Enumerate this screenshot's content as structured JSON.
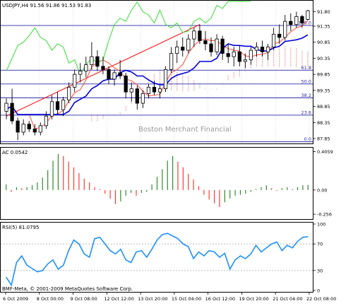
{
  "colors": {
    "background": "#ffffff",
    "frame": "#000000",
    "grid": "#c9c9c9",
    "candle": "#000000",
    "candle_up_fill": "#ffffff",
    "fib_line": "#2a2aa8",
    "fib_label": "#2a2aa8",
    "trendline": "#ff0000",
    "chikou": "#33dd33",
    "tenkan": "#ff4a3a",
    "kijun": "#0000dd",
    "cloud": "#e8a0a0",
    "cloud_dots": "#ffb080",
    "ac_up": "#2e8b2e",
    "ac_down": "#ff3b30",
    "rsi_line": "#1e90ff",
    "rsi_level": "#b5b5b5",
    "watermark": "#9a9a9a"
  },
  "main_panel": {
    "title": "USDJPY,H4  91.56 91.86 91.53 91.83",
    "watermark": "Boston Merchant Financial",
    "fib_levels": [
      {
        "label": "100.0",
        "price": 91.37
      },
      {
        "label": "61.8",
        "price": 89.98
      },
      {
        "label": "50.0",
        "price": 89.55
      },
      {
        "label": "38.2",
        "price": 89.12
      },
      {
        "label": "23.6",
        "price": 88.58
      },
      {
        "label": "0.0",
        "price": 87.75
      }
    ]
  },
  "ac_panel": {
    "title": "AC 0.0542"
  },
  "rsi_panel": {
    "title": "RSI(5) 81.0795"
  },
  "footer": {
    "copyright": "BMF-Meta, © 2001-2009 MetaQuotes Software Corp."
  },
  "chart_data": [
    {
      "type": "candlestick",
      "title": "USDJPY,H4  91.56 91.86 91.53 91.83",
      "symbol": "USDJPY",
      "timeframe": "H4",
      "last_bar": {
        "open": 91.56,
        "high": 91.86,
        "low": 91.53,
        "close": 91.83
      },
      "x_tick_labels": [
        "6 Oct 2009",
        "8 Oct 00:00",
        "9 Oct 08:00",
        "12 Oct 12:00",
        "13 Oct 20:00",
        "15 Oct 04:00",
        "16 Oct 12:00",
        "19 Oct 20:00",
        "21 Oct 04:00",
        "22 Oct 08:00"
      ],
      "y_tick_labels": [
        "91.80",
        "91.35",
        "90.85",
        "90.35",
        "89.85",
        "89.35",
        "88.85",
        "88.35",
        "87.85"
      ],
      "ylim": [
        87.72,
        92.12
      ],
      "grid": false,
      "candles": [
        {
          "o": 88.7,
          "h": 89.1,
          "l": 88.45,
          "c": 88.95
        },
        {
          "o": 88.95,
          "h": 89.4,
          "l": 88.3,
          "c": 88.4
        },
        {
          "o": 88.4,
          "h": 88.5,
          "l": 87.8,
          "c": 88.05
        },
        {
          "o": 88.05,
          "h": 88.45,
          "l": 87.95,
          "c": 88.3
        },
        {
          "o": 88.3,
          "h": 88.4,
          "l": 88.05,
          "c": 88.15
        },
        {
          "o": 88.15,
          "h": 88.3,
          "l": 87.95,
          "c": 88.05
        },
        {
          "o": 88.05,
          "h": 88.35,
          "l": 87.95,
          "c": 88.25
        },
        {
          "o": 88.25,
          "h": 88.7,
          "l": 88.15,
          "c": 88.55
        },
        {
          "o": 88.55,
          "h": 89.2,
          "l": 88.45,
          "c": 89.0
        },
        {
          "o": 89.0,
          "h": 89.3,
          "l": 88.6,
          "c": 88.75
        },
        {
          "o": 88.75,
          "h": 89.15,
          "l": 88.55,
          "c": 89.05
        },
        {
          "o": 89.05,
          "h": 89.6,
          "l": 88.95,
          "c": 89.45
        },
        {
          "o": 89.45,
          "h": 90.0,
          "l": 89.3,
          "c": 89.85
        },
        {
          "o": 89.85,
          "h": 90.2,
          "l": 89.6,
          "c": 89.95
        },
        {
          "o": 89.95,
          "h": 90.4,
          "l": 89.75,
          "c": 90.15
        },
        {
          "o": 90.15,
          "h": 90.85,
          "l": 90.0,
          "c": 90.4
        },
        {
          "o": 90.4,
          "h": 90.6,
          "l": 89.95,
          "c": 90.1
        },
        {
          "o": 90.1,
          "h": 90.4,
          "l": 89.85,
          "c": 90.0
        },
        {
          "o": 90.0,
          "h": 90.1,
          "l": 89.55,
          "c": 89.7
        },
        {
          "o": 89.7,
          "h": 90.0,
          "l": 89.5,
          "c": 89.9
        },
        {
          "o": 89.9,
          "h": 90.3,
          "l": 89.7,
          "c": 89.8
        },
        {
          "o": 89.8,
          "h": 89.9,
          "l": 89.1,
          "c": 89.3
        },
        {
          "o": 89.3,
          "h": 89.6,
          "l": 89.0,
          "c": 89.4
        },
        {
          "o": 89.4,
          "h": 89.5,
          "l": 88.75,
          "c": 88.95
        },
        {
          "o": 88.95,
          "h": 89.35,
          "l": 88.8,
          "c": 89.25
        },
        {
          "o": 89.25,
          "h": 89.55,
          "l": 89.1,
          "c": 89.45
        },
        {
          "o": 89.45,
          "h": 89.65,
          "l": 89.2,
          "c": 89.3
        },
        {
          "o": 89.3,
          "h": 89.5,
          "l": 89.1,
          "c": 89.4
        },
        {
          "o": 89.4,
          "h": 90.1,
          "l": 89.3,
          "c": 90.0
        },
        {
          "o": 90.0,
          "h": 90.7,
          "l": 89.9,
          "c": 90.5
        },
        {
          "o": 90.5,
          "h": 90.9,
          "l": 90.2,
          "c": 90.7
        },
        {
          "o": 90.7,
          "h": 91.0,
          "l": 90.4,
          "c": 90.6
        },
        {
          "o": 90.6,
          "h": 91.1,
          "l": 90.5,
          "c": 90.95
        },
        {
          "o": 90.95,
          "h": 91.3,
          "l": 90.7,
          "c": 91.2
        },
        {
          "o": 91.2,
          "h": 91.4,
          "l": 90.8,
          "c": 90.9
        },
        {
          "o": 90.9,
          "h": 91.2,
          "l": 90.6,
          "c": 90.8
        },
        {
          "o": 90.8,
          "h": 91.0,
          "l": 90.4,
          "c": 90.55
        },
        {
          "o": 90.55,
          "h": 91.1,
          "l": 90.45,
          "c": 90.95
        },
        {
          "o": 90.95,
          "h": 91.05,
          "l": 90.3,
          "c": 90.5
        },
        {
          "o": 90.5,
          "h": 90.8,
          "l": 90.2,
          "c": 90.4
        },
        {
          "o": 90.4,
          "h": 90.7,
          "l": 90.1,
          "c": 90.55
        },
        {
          "o": 90.55,
          "h": 90.75,
          "l": 90.1,
          "c": 90.25
        },
        {
          "o": 90.25,
          "h": 90.5,
          "l": 90.05,
          "c": 90.3
        },
        {
          "o": 90.3,
          "h": 90.7,
          "l": 90.15,
          "c": 90.6
        },
        {
          "o": 90.6,
          "h": 90.85,
          "l": 90.4,
          "c": 90.7
        },
        {
          "o": 90.7,
          "h": 90.9,
          "l": 90.4,
          "c": 90.55
        },
        {
          "o": 90.55,
          "h": 90.8,
          "l": 90.3,
          "c": 90.7
        },
        {
          "o": 90.7,
          "h": 91.3,
          "l": 90.6,
          "c": 91.1
        },
        {
          "o": 91.1,
          "h": 91.4,
          "l": 90.8,
          "c": 91.0
        },
        {
          "o": 91.0,
          "h": 91.7,
          "l": 90.9,
          "c": 91.5
        },
        {
          "o": 91.5,
          "h": 91.75,
          "l": 91.2,
          "c": 91.4
        },
        {
          "o": 91.4,
          "h": 91.8,
          "l": 91.3,
          "c": 91.65
        },
        {
          "o": 91.65,
          "h": 91.7,
          "l": 91.3,
          "c": 91.45
        },
        {
          "o": 91.56,
          "h": 91.86,
          "l": 91.53,
          "c": 91.83
        }
      ]
    },
    {
      "type": "bar",
      "title": "AC 0.0542",
      "name": "AC",
      "y_tick_labels": [
        "0.4059",
        "0.00",
        "-0.256"
      ],
      "ylim": [
        -0.3,
        0.44
      ],
      "values": [
        0.06,
        -0.02,
        0.03,
        0.02,
        0.03,
        0.05,
        0.08,
        0.13,
        0.21,
        0.31,
        0.38,
        0.36,
        0.3,
        0.24,
        0.18,
        0.12,
        0.08,
        0.03,
        0.01,
        -0.04,
        -0.09,
        -0.15,
        -0.12,
        -0.06,
        -0.03,
        -0.06,
        -0.03,
        -0.02,
        0.06,
        0.14,
        0.22,
        0.31,
        0.36,
        0.3,
        0.24,
        0.17,
        0.11,
        0.04,
        -0.05,
        -0.1,
        -0.14,
        -0.18,
        -0.13,
        -0.09,
        -0.06,
        -0.05,
        -0.04,
        -0.02,
        0.01,
        0.03,
        0.05,
        0.02,
        -0.01,
        0.02,
        0.03,
        0.01,
        0.03,
        0.05,
        0.054
      ]
    },
    {
      "type": "line",
      "title": "RSI(5) 81.0795",
      "name": "RSI(5)",
      "y_tick_labels": [
        "100",
        "70",
        "30",
        "0"
      ],
      "levels": [
        70,
        30
      ],
      "ylim": [
        0,
        100
      ],
      "values": [
        20,
        8,
        42,
        52,
        38,
        33,
        28,
        30,
        40,
        46,
        32,
        38,
        60,
        76,
        70,
        55,
        50,
        78,
        80,
        70,
        60,
        55,
        62,
        46,
        42,
        58,
        60,
        50,
        62,
        76,
        84,
        86,
        82,
        78,
        70,
        66,
        48,
        58,
        52,
        60,
        58,
        50,
        56,
        32,
        46,
        52,
        48,
        55,
        68,
        58,
        64,
        70,
        73,
        60,
        68,
        64,
        74,
        80,
        81
      ]
    }
  ]
}
